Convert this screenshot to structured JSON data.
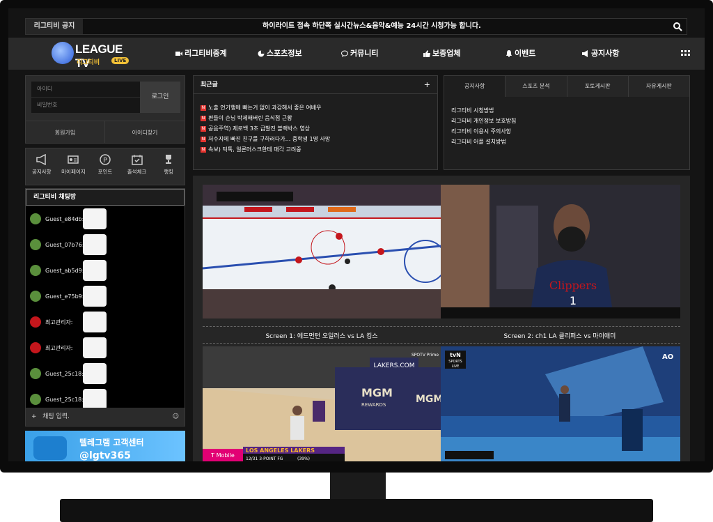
{
  "notice": {
    "tag": "리그티비 공지",
    "message": "하이라이트 접속 하단쪽 실시간뉴스&음악&예능 24시간 시청가능 합니다."
  },
  "logo": {
    "name": "LEAGUE TV",
    "sub": "리그티비",
    "badge": "LIVE"
  },
  "menu": [
    {
      "label": "리그티비중계",
      "icon": "video-icon"
    },
    {
      "label": "스포츠정보",
      "icon": "pie-icon"
    },
    {
      "label": "커뮤니티",
      "icon": "chat-icon"
    },
    {
      "label": "보증업체",
      "icon": "thumb-icon"
    },
    {
      "label": "이벤트",
      "icon": "bell-icon"
    },
    {
      "label": "공지사항",
      "icon": "megaphone-icon"
    }
  ],
  "login": {
    "id_placeholder": "아이디",
    "pw_placeholder": "비밀번호",
    "button": "로그인",
    "join": "회원가입",
    "find": "아이디찾기"
  },
  "quick": [
    {
      "label": "공지사항",
      "icon": "megaphone-icon"
    },
    {
      "label": "마이페이지",
      "icon": "id-card-icon"
    },
    {
      "label": "포인트",
      "icon": "point-icon"
    },
    {
      "label": "출석체크",
      "icon": "calendar-icon"
    },
    {
      "label": "랭킹",
      "icon": "trophy-icon"
    }
  ],
  "chat": {
    "title": "리그티비 채팅방",
    "messages": [
      {
        "name": "Guest_e84db:",
        "role": "guest"
      },
      {
        "name": "Guest_07b76:",
        "role": "guest"
      },
      {
        "name": "Guest_ab5d9:",
        "role": "guest"
      },
      {
        "name": "Guest_e75b9:",
        "role": "guest"
      },
      {
        "name": "최고관리자:",
        "role": "admin"
      },
      {
        "name": "최고관리자:",
        "role": "admin"
      },
      {
        "name": "Guest_25c18:",
        "role": "guest"
      },
      {
        "name": "Guest_25c18:",
        "role": "guest"
      }
    ],
    "input_placeholder": "채팅 입력."
  },
  "telegram": {
    "line1": "텔레그램 고객센터",
    "line2": "@lgtv365"
  },
  "recent": {
    "title": "최근글",
    "plus": "+",
    "items": [
      "노출 언기행에 빠는거 없이 과감해서 좋은 여배우",
      "편들이 손님 박제해버린 음식점 근황",
      "공음주역) 제로백 3초 급발진 블랙박스 영상",
      "저수지에 빠진 친구를 구하러다가... 중학생 1명 사망",
      "속보) 틱톡, 일론머스크한테 매각 고려중"
    ]
  },
  "board": {
    "tabs": [
      "공지사항",
      "스포츠 분석",
      "포토게시판",
      "자유게시판"
    ],
    "items": [
      "리그티비 시청방법",
      "리그티비 개인정보 보호방침",
      "리그티비 이용시 주의사항",
      "리그티비 어플 설치방법"
    ]
  },
  "screens": [
    {
      "caption": "Screen 1: 에드먼턴 오일러스 vs LA 킹스"
    },
    {
      "caption": "Screen 2: ch1 LA 클리퍼스 vs 마이애미"
    }
  ],
  "overlays": {
    "lakers": "LOS ANGELES LAKERS",
    "lakers_sub": "12/31 3-POINT FG",
    "lakers_pct": "(39%)",
    "tmobile": "T Mobile",
    "lakers_com": "LAKERS.COM",
    "mgm1": "MGM",
    "rewards": "REWARDS",
    "mgm2": "MGM",
    "tvn": "tvN",
    "sports": "SPORTS",
    "live": "LIVE",
    "clippers": "Clippers",
    "jersey_num": "1",
    "ao": "AO",
    "spotv": "SPOTV Prime"
  }
}
